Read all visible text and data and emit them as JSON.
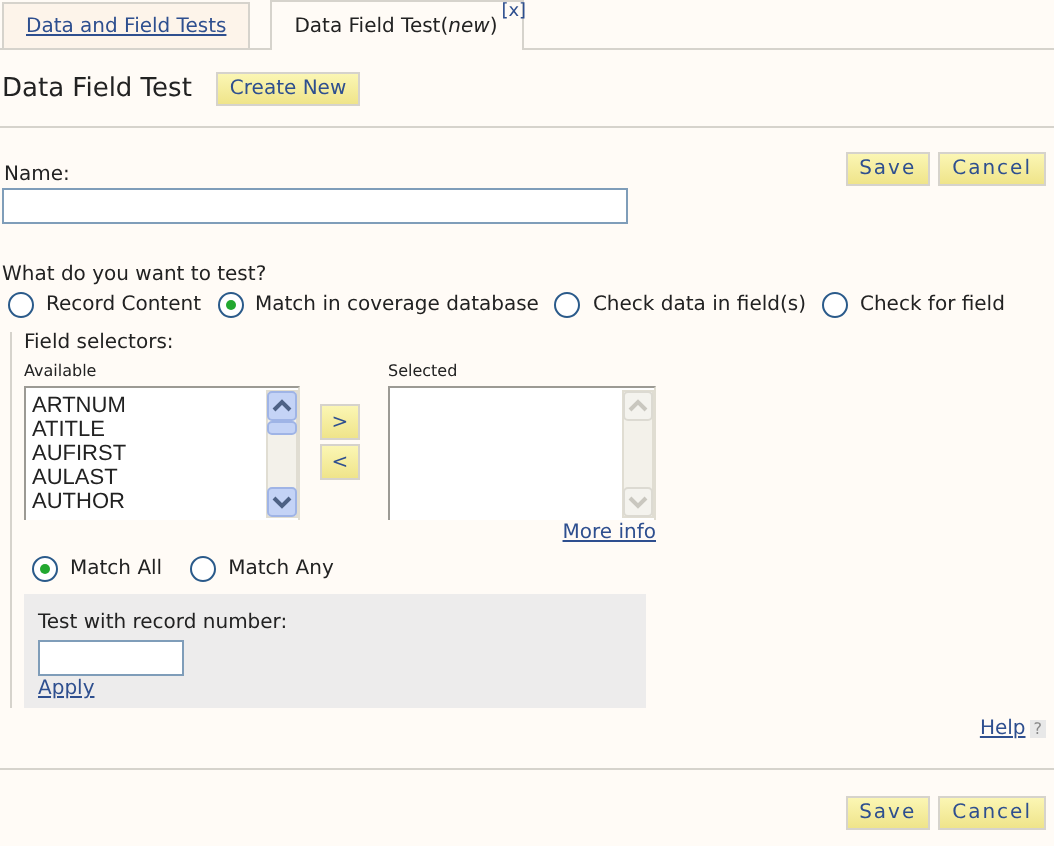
{
  "tabs": [
    {
      "label": "Data and Field Tests",
      "selected": false
    },
    {
      "label": "Data Field Test(*new*)",
      "selected": true
    }
  ],
  "tab_close": "[x]",
  "header": {
    "title": "Data Field Test",
    "button": "Create New"
  },
  "top_buttons": [
    "Save",
    "Cancel"
  ],
  "name_field": {
    "label": "Name:"
  },
  "test_question": "What do you want to test?",
  "test_options": [
    {
      "label": "Record Content",
      "selected": false
    },
    {
      "label": "Match in coverage database",
      "selected": true
    },
    {
      "label": "Check data in field(s)",
      "selected": false
    },
    {
      "label": "Check for field",
      "selected": false
    }
  ],
  "field_selectors": {
    "label": "Field selectors:",
    "available_label": "Available",
    "available": [
      "ARTNUM",
      "ATITLE",
      "AUFIRST",
      "AULAST",
      "AUTHOR"
    ],
    "selected_label": "Selected",
    "add_button": ">",
    "remove_button": "<",
    "more_info": "More info"
  },
  "match_options": [
    {
      "label": "Match All",
      "selected": true
    },
    {
      "label": "Match Any",
      "selected": false
    }
  ],
  "record_test": {
    "label": "Test with record number:",
    "apply": "Apply"
  },
  "help": {
    "label": "Help",
    "icon": "?"
  },
  "bottom_buttons": [
    "Save",
    "Cancel"
  ]
}
